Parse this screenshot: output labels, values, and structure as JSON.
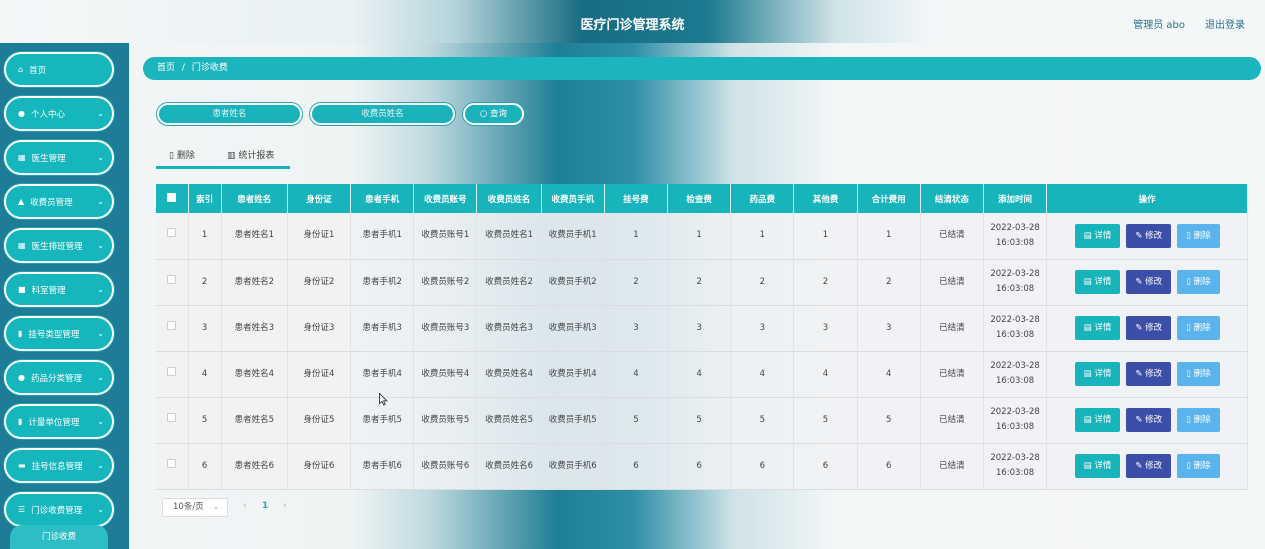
{
  "header": {
    "title": "医疗门诊管理系统",
    "admin": "管理员 abo",
    "logout": "退出登录"
  },
  "sidebar": {
    "items": [
      {
        "label": "首页",
        "icon": "home-icon",
        "glyph": "⌂",
        "has_children": false
      },
      {
        "label": "个人中心",
        "icon": "user-icon",
        "glyph": "●",
        "has_children": true
      },
      {
        "label": "医生管理",
        "icon": "grid-icon",
        "glyph": "▦",
        "has_children": true
      },
      {
        "label": "收费员管理",
        "icon": "thumb-icon",
        "glyph": "▲",
        "has_children": true
      },
      {
        "label": "医生排班管理",
        "icon": "grid-icon",
        "glyph": "▦",
        "has_children": true
      },
      {
        "label": "科室管理",
        "icon": "briefcase-icon",
        "glyph": "■",
        "has_children": true
      },
      {
        "label": "挂号类型管理",
        "icon": "clipboard-icon",
        "glyph": "▮",
        "has_children": true
      },
      {
        "label": "药品分类管理",
        "icon": "pin-icon",
        "glyph": "●",
        "has_children": true
      },
      {
        "label": "计量单位管理",
        "icon": "clipboard-icon",
        "glyph": "▮",
        "has_children": true
      },
      {
        "label": "挂号信息管理",
        "icon": "card-icon",
        "glyph": "▬",
        "has_children": true
      },
      {
        "label": "门诊收费管理",
        "icon": "sliders-icon",
        "glyph": "☰",
        "has_children": true
      }
    ],
    "submenu": "门诊收费"
  },
  "breadcrumb": {
    "home": "首页",
    "sep": "/",
    "current": "门诊收费"
  },
  "search": {
    "patient_placeholder": "患者姓名",
    "cashier_placeholder": "收费员姓名",
    "button": "查询"
  },
  "actions": {
    "delete": "删除",
    "stats": "统计报表"
  },
  "table": {
    "headers": [
      "索引",
      "患者姓名",
      "身份证",
      "患者手机",
      "收费员账号",
      "收费员姓名",
      "收费员手机",
      "挂号费",
      "检查费",
      "药品费",
      "其他费",
      "合计费用",
      "结清状态",
      "添加时间",
      "操作"
    ],
    "rows": [
      {
        "index": "1",
        "name": "患者姓名1",
        "id_card": "身份证1",
        "phone": "患者手机1",
        "cashier_account": "收费员账号1",
        "cashier_name": "收费员姓名1",
        "cashier_phone": "收费员手机1",
        "reg_fee": "1",
        "exam_fee": "1",
        "drug_fee": "1",
        "other_fee": "1",
        "total": "1",
        "status": "已结清",
        "time": "2022-03-28 16:03:08"
      },
      {
        "index": "2",
        "name": "患者姓名2",
        "id_card": "身份证2",
        "phone": "患者手机2",
        "cashier_account": "收费员账号2",
        "cashier_name": "收费员姓名2",
        "cashier_phone": "收费员手机2",
        "reg_fee": "2",
        "exam_fee": "2",
        "drug_fee": "2",
        "other_fee": "2",
        "total": "2",
        "status": "已结清",
        "time": "2022-03-28 16:03:08"
      },
      {
        "index": "3",
        "name": "患者姓名3",
        "id_card": "身份证3",
        "phone": "患者手机3",
        "cashier_account": "收费员账号3",
        "cashier_name": "收费员姓名3",
        "cashier_phone": "收费员手机3",
        "reg_fee": "3",
        "exam_fee": "3",
        "drug_fee": "3",
        "other_fee": "3",
        "total": "3",
        "status": "已结清",
        "time": "2022-03-28 16:03:08"
      },
      {
        "index": "4",
        "name": "患者姓名4",
        "id_card": "身份证4",
        "phone": "患者手机4",
        "cashier_account": "收费员账号4",
        "cashier_name": "收费员姓名4",
        "cashier_phone": "收费员手机4",
        "reg_fee": "4",
        "exam_fee": "4",
        "drug_fee": "4",
        "other_fee": "4",
        "total": "4",
        "status": "已结清",
        "time": "2022-03-28 16:03:08"
      },
      {
        "index": "5",
        "name": "患者姓名5",
        "id_card": "身份证5",
        "phone": "患者手机5",
        "cashier_account": "收费员账号5",
        "cashier_name": "收费员姓名5",
        "cashier_phone": "收费员手机5",
        "reg_fee": "5",
        "exam_fee": "5",
        "drug_fee": "5",
        "other_fee": "5",
        "total": "5",
        "status": "已结清",
        "time": "2022-03-28 16:03:08"
      },
      {
        "index": "6",
        "name": "患者姓名6",
        "id_card": "身份证6",
        "phone": "患者手机6",
        "cashier_account": "收费员账号6",
        "cashier_name": "收费员姓名6",
        "cashier_phone": "收费员手机6",
        "reg_fee": "6",
        "exam_fee": "6",
        "drug_fee": "6",
        "other_fee": "6",
        "total": "6",
        "status": "已结清",
        "time": "2022-03-28 16:03:08"
      }
    ],
    "buttons": {
      "detail": "详情",
      "edit": "修改",
      "delete": "删除"
    }
  },
  "pagination": {
    "page_size": "10条/页",
    "current_page": "1"
  },
  "colors": {
    "accent": "#18b4bb",
    "edit": "#3c4fa8",
    "delete": "#5ab3ec",
    "sidebar": "#1e7c96"
  }
}
